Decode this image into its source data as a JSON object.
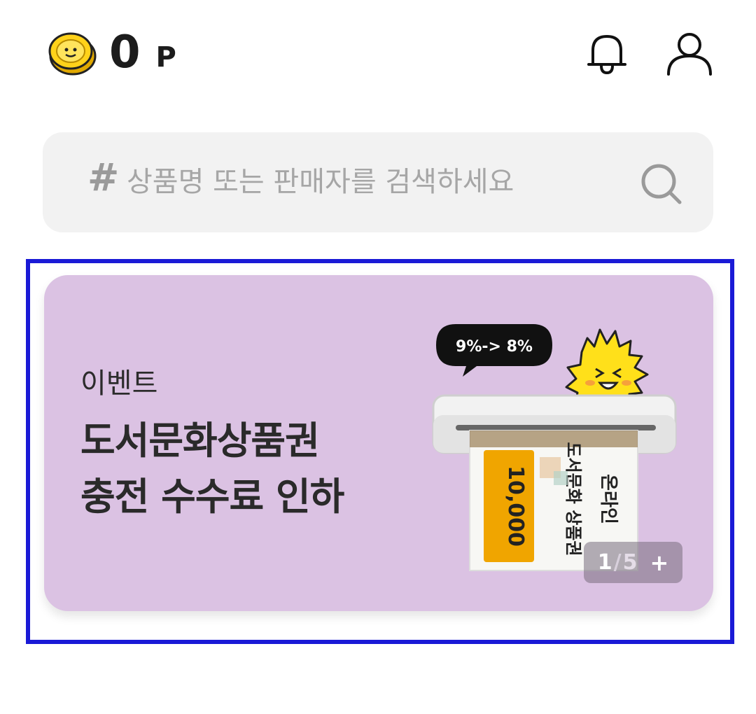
{
  "header": {
    "points_value": "0",
    "points_unit": "P",
    "coin_icon": "coin-icon",
    "bell_icon": "bell-icon",
    "user_icon": "user-icon"
  },
  "search": {
    "hash": "#",
    "placeholder": "상품명 또는 판매자를 검색하세요",
    "icon": "search-icon"
  },
  "banner": {
    "category": "이벤트",
    "title_line1": "도서문화상품권",
    "title_line2": "충전 수수료 인하",
    "speech_text": "9%-> 8%",
    "voucher_amount": "10,000",
    "voucher_title": "도서문화 상품권",
    "voucher_online": "온라인",
    "pager_current": "1",
    "pager_total": "5",
    "pager_more": "+",
    "background_color": "#dbc2e3"
  },
  "colors": {
    "banner_outline": "#1a1ad6",
    "search_bg": "#f2f2f2"
  }
}
